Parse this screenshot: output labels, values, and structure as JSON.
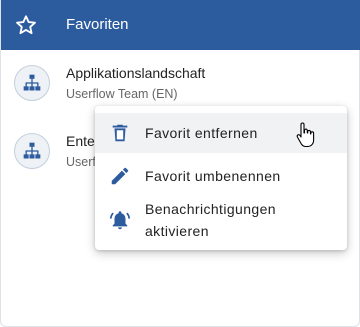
{
  "header": {
    "title": "Favoriten",
    "icon": "star-outline-icon"
  },
  "favorites": [
    {
      "name": "Applikationslandschaft",
      "subtitle": "Userflow Team (EN)",
      "icon": "sitemap-icon"
    },
    {
      "name": "Ente",
      "subtitle": "Userf",
      "icon": "sitemap-icon"
    }
  ],
  "context_menu": {
    "items": [
      {
        "label": "Favorit entfernen",
        "icon": "trash-icon"
      },
      {
        "label": "Favorit umbenennen",
        "icon": "pencil-icon"
      },
      {
        "label_line1": "Benachrichtigungen",
        "label_line2": "aktivieren",
        "icon": "bell-ring-icon"
      }
    ]
  },
  "colors": {
    "header": "#2c5b9e",
    "icon_blue": "#2c5b9e",
    "hover": "#f1f2f4"
  }
}
